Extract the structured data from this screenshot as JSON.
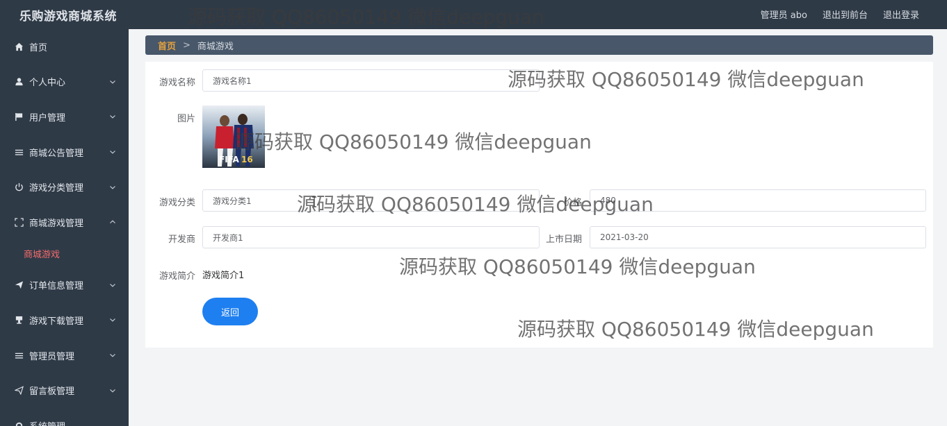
{
  "app": {
    "title": "乐购游戏商城系统"
  },
  "topbar": {
    "admin_label": "管理员 abo",
    "to_front": "退出到前台",
    "logout": "退出登录"
  },
  "sidebar": {
    "items": [
      {
        "label": "首页",
        "icon": "home-icon"
      },
      {
        "label": "个人中心",
        "icon": "user-icon"
      },
      {
        "label": "用户管理",
        "icon": "flag-icon"
      },
      {
        "label": "商城公告管理",
        "icon": "list-icon"
      },
      {
        "label": "游戏分类管理",
        "icon": "power-icon"
      },
      {
        "label": "商城游戏管理",
        "icon": "fullscreen-icon",
        "expanded": true,
        "sub": [
          {
            "label": "商城游戏",
            "active": true
          }
        ]
      },
      {
        "label": "订单信息管理",
        "icon": "send-icon"
      },
      {
        "label": "游戏下载管理",
        "icon": "download-icon"
      },
      {
        "label": "管理员管理",
        "icon": "list-icon"
      },
      {
        "label": "留言板管理",
        "icon": "send-icon"
      },
      {
        "label": "系统管理",
        "icon": "gear-icon"
      }
    ]
  },
  "breadcrumb": {
    "home": "首页",
    "separator": ">",
    "current": "商城游戏"
  },
  "form": {
    "name_label": "游戏名称",
    "name_value": "游戏名称1",
    "image_label": "图片",
    "category_label": "游戏分类",
    "category_value": "游戏分类1",
    "price_label": "价格",
    "price_value": "480",
    "developer_label": "开发商",
    "developer_value": "开发商1",
    "release_label": "上市日期",
    "release_value": "2021-03-20",
    "intro_label": "游戏简介",
    "intro_value": "游戏简介1",
    "back_button": "返回"
  },
  "watermark": {
    "text": "源码获取 QQ86050149 微信deepguan"
  },
  "colors": {
    "sidebar_bg": "#2f3a47",
    "breadcrumb_bg": "#48576a",
    "accent": "#1e7ff0",
    "active_sub": "#f56c6c",
    "breadcrumb_home": "#e6a23c"
  }
}
